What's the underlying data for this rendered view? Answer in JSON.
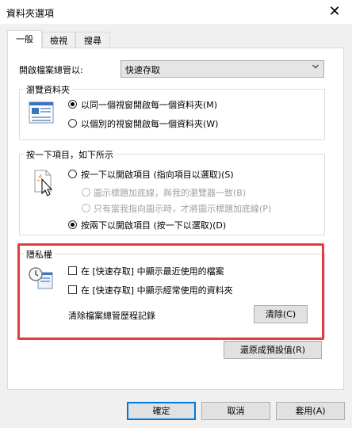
{
  "window": {
    "title": "資料夾選項",
    "close_glyph": "✕"
  },
  "tabs": [
    {
      "label": "一般",
      "active": true
    },
    {
      "label": "檢視",
      "active": false
    },
    {
      "label": "搜尋",
      "active": false
    }
  ],
  "open_explorer": {
    "label": "開啟檔案總管以:",
    "value": "快速存取"
  },
  "browse": {
    "legend": "瀏覽資料夾",
    "options": [
      {
        "label": "以同一個視窗開啟每一個資料夾(M)",
        "checked": true
      },
      {
        "label": "以個別的視窗開啟每一個資料夾(W)",
        "checked": false
      }
    ]
  },
  "click": {
    "legend": "按一下項目，如下所示",
    "single": {
      "label": "按一下以開啟項目 (指向項目以選取)(S)",
      "checked": false
    },
    "sub_options": [
      {
        "label": "圖示標題加底線，與我的瀏覽器一致(B)",
        "disabled": true
      },
      {
        "label": "只有當我指向圖示時，才將圖示標題加底線(P)",
        "disabled": true
      }
    ],
    "double": {
      "label": "按兩下以開啟項目 (按一下以選取)(D)",
      "checked": true
    }
  },
  "privacy": {
    "legend": "隱私權",
    "checkboxes": [
      {
        "label": "在 [快速存取] 中顯示最近使用的檔案",
        "checked": false
      },
      {
        "label": "在 [快速存取] 中顯示經常使用的資料夾",
        "checked": false
      }
    ],
    "clear_label": "清除檔案總管歷程記錄",
    "clear_button": "清除(C)"
  },
  "restore_button": "還原成預設值(R)",
  "footer": {
    "ok": "確定",
    "cancel": "取消",
    "apply": "套用(A)"
  },
  "colors": {
    "highlight": "#e23c3c",
    "accent": "#0078d7"
  }
}
